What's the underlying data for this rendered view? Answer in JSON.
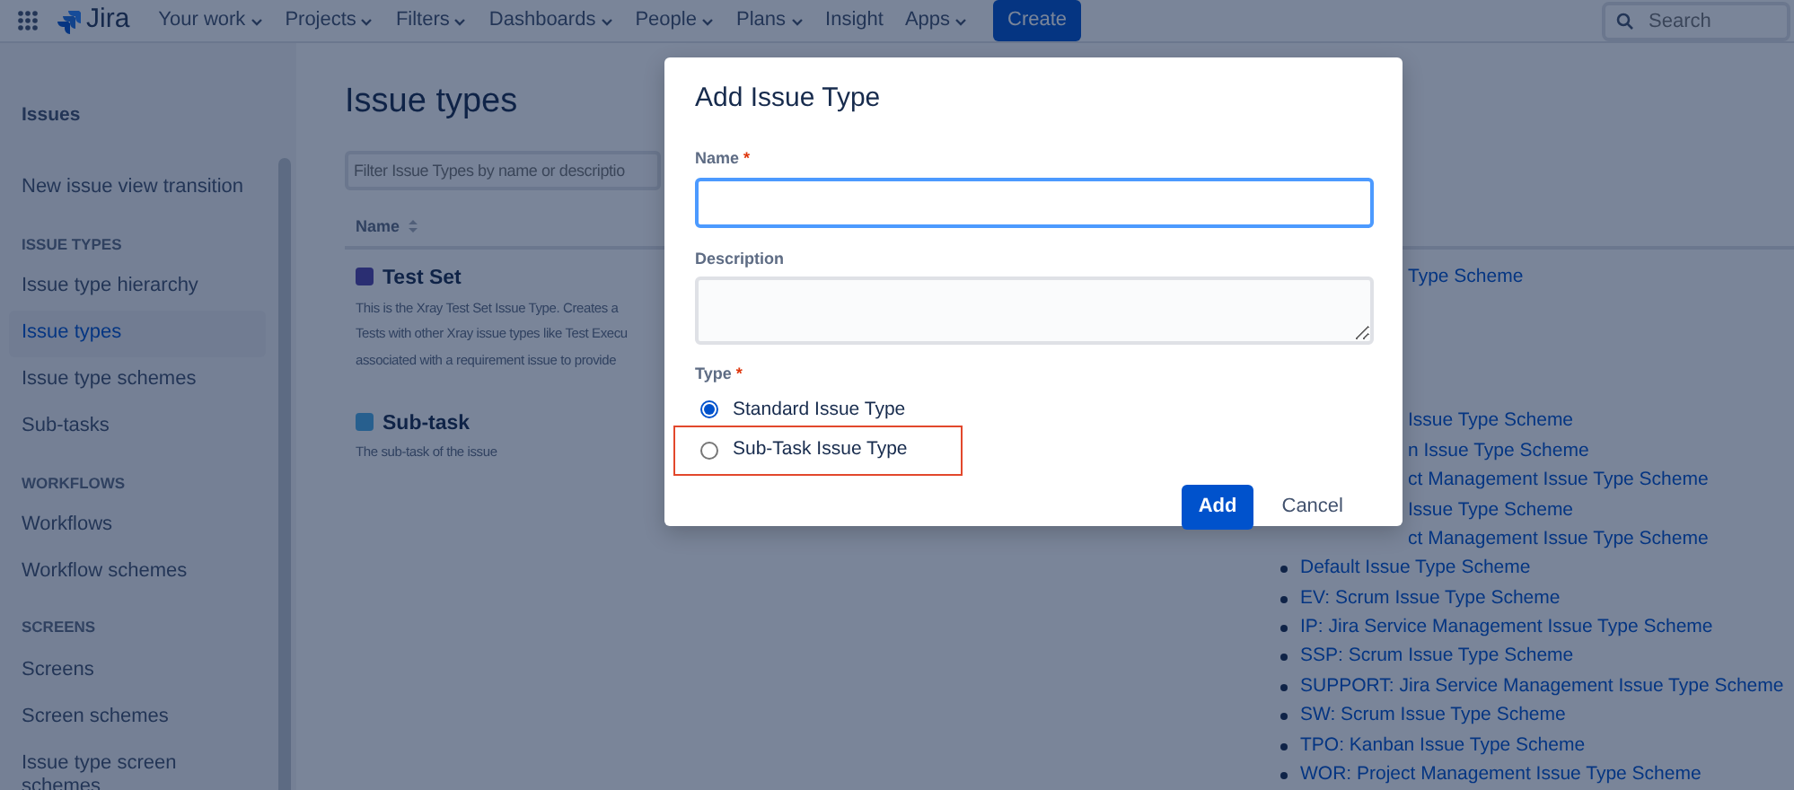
{
  "nav": {
    "logo": "Jira",
    "items": [
      {
        "label": "Your work",
        "dropdown": true
      },
      {
        "label": "Projects",
        "dropdown": true
      },
      {
        "label": "Filters",
        "dropdown": true
      },
      {
        "label": "Dashboards",
        "dropdown": true
      },
      {
        "label": "People",
        "dropdown": true
      },
      {
        "label": "Plans",
        "dropdown": true
      },
      {
        "label": "Insight",
        "dropdown": false
      },
      {
        "label": "Apps",
        "dropdown": true
      }
    ],
    "create": "Create",
    "search_placeholder": "Search"
  },
  "sidebar": {
    "title": "Issues",
    "sections": [
      {
        "items": [
          {
            "label": "New issue view transition",
            "selected": false
          }
        ]
      },
      {
        "header": "ISSUE TYPES",
        "items": [
          {
            "label": "Issue type hierarchy",
            "selected": false
          },
          {
            "label": "Issue types",
            "selected": true
          },
          {
            "label": "Issue type schemes",
            "selected": false
          },
          {
            "label": "Sub-tasks",
            "selected": false
          }
        ]
      },
      {
        "header": "WORKFLOWS",
        "items": [
          {
            "label": "Workflows",
            "selected": false
          },
          {
            "label": "Workflow schemes",
            "selected": false
          }
        ]
      },
      {
        "header": "SCREENS",
        "items": [
          {
            "label": "Screens",
            "selected": false
          },
          {
            "label": "Screen schemes",
            "selected": false
          },
          {
            "label": "Issue type screen schemes",
            "selected": false
          }
        ]
      }
    ]
  },
  "page": {
    "title": "Issue types",
    "filter_placeholder": "Filter Issue Types by name or descriptio",
    "columns": [
      "Name"
    ],
    "rows": [
      {
        "name": "Test Set",
        "kind": "test-set",
        "description_lines": [
          "This is the Xray Test Set Issue Type. Creates a",
          "Tests with other Xray issue types like Test Execu",
          "associated with a requirement issue to provide"
        ],
        "schemes": [
          {
            "text": "Type Scheme",
            "kind": "partial"
          }
        ]
      },
      {
        "name": "Sub-task",
        "kind": "subtask",
        "description_lines": [
          "The sub-task of the issue"
        ],
        "schemes": [
          {
            "text": "Issue Type Scheme",
            "kind": "partial"
          },
          {
            "text": "n Issue Type Scheme",
            "kind": "partial"
          },
          {
            "text": "ct Management Issue Type Scheme",
            "kind": "partial"
          },
          {
            "text": "Issue Type Scheme",
            "kind": "partial"
          },
          {
            "text": "ct Management Issue Type Scheme",
            "kind": "partial"
          },
          {
            "text": "Default Issue Type Scheme",
            "kind": "full"
          },
          {
            "text": "EV: Scrum Issue Type Scheme",
            "kind": "full"
          },
          {
            "text": "IP: Jira Service Management Issue Type Scheme",
            "kind": "full"
          },
          {
            "text": "SSP: Scrum Issue Type Scheme",
            "kind": "full"
          },
          {
            "text": "SUPPORT: Jira Service Management Issue Type Scheme",
            "kind": "full"
          },
          {
            "text": "SW: Scrum Issue Type Scheme",
            "kind": "full"
          },
          {
            "text": "TPO: Kanban Issue Type Scheme",
            "kind": "full"
          },
          {
            "text": "WOR: Project Management Issue Type Scheme",
            "kind": "full"
          }
        ]
      }
    ]
  },
  "dialog": {
    "title": "Add Issue Type",
    "fields": [
      {
        "label": "Name",
        "required_mark": "*",
        "kind": "input",
        "focused": true
      },
      {
        "label": "Description",
        "kind": "textarea",
        "focused": false
      }
    ],
    "type_label": "Type",
    "type_required_mark": "*",
    "options": [
      {
        "label": "Standard Issue Type",
        "selected": true,
        "highlighted": false
      },
      {
        "label": "Sub-Task Issue Type",
        "selected": false,
        "highlighted": true
      }
    ],
    "buttons": [
      {
        "label": "Add",
        "kind": "primary"
      },
      {
        "label": "Cancel",
        "kind": "link"
      }
    ]
  }
}
